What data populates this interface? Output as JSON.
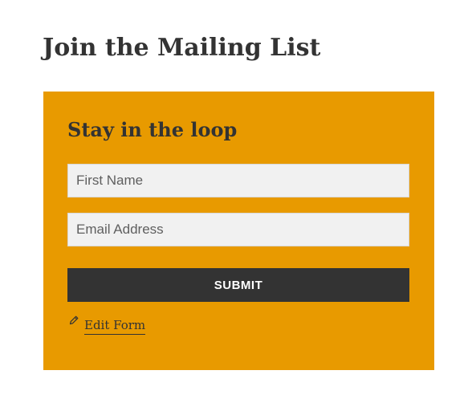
{
  "page": {
    "title": "Join the Mailing List"
  },
  "form": {
    "heading": "Stay in the loop",
    "first_name": {
      "value": "",
      "placeholder": "First Name"
    },
    "email": {
      "value": "",
      "placeholder": "Email Address"
    },
    "submit_label": "SUBMIT",
    "edit_link": {
      "label": "Edit Form",
      "icon": "pencil-icon"
    }
  },
  "colors": {
    "panel_background": "#e89a00",
    "button_background": "#333333",
    "text": "#333333",
    "field_background": "#f1f1f1"
  }
}
